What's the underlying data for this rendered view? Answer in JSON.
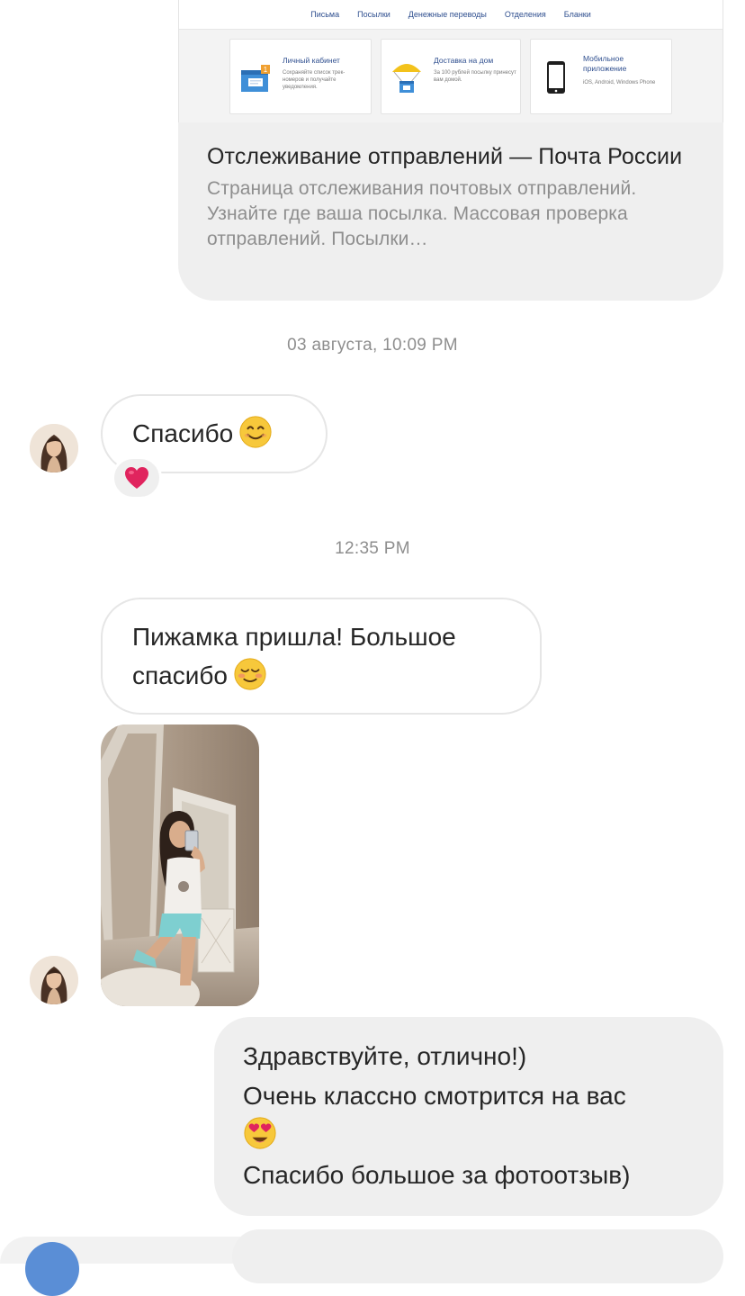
{
  "link_preview": {
    "nav_items": [
      "Письма",
      "Посылки",
      "Денежные переводы",
      "Отделения",
      "Бланки"
    ],
    "mini_cards": [
      {
        "title": "Личный кабинет",
        "desc": "Сохраняйте список трек-номеров и получайте уведомления."
      },
      {
        "title": "Доставка на дом",
        "desc": "За 100 рублей посылку принесут вам домой."
      },
      {
        "title": "Мобильное приложение",
        "desc": "iOS, Android, Windows Phone"
      }
    ],
    "badge_number": "1",
    "title": "Отслеживание отправлений — Почта России",
    "description": "Страница отслеживания почтовых отправлений. Узнайте где ваша посылка. Массовая проверка отправлений. Посылки…"
  },
  "timestamps": {
    "first": "03 августа, 10:09 PM",
    "second": "12:35 PM"
  },
  "messages": {
    "thanks": "Спасибо",
    "thanks_emoji": "smiling-face-icon",
    "reaction": "heart-icon",
    "pajama_line1": "Пижамка пришла! Большое",
    "pajama_line2": "спасибо",
    "pajama_emoji": "blushing-face-icon",
    "reply_line1": "Здравствуйте, отлично!)",
    "reply_line2": "Очень классно смотрится на вас",
    "reply_emoji": "heart-eyes-icon",
    "reply_line3": "Спасибо большое за фотоотзыв)"
  },
  "colors": {
    "outgoing_bubble": "#efefef",
    "incoming_border": "#e6e6e6",
    "timestamp_text": "#8e8e8e",
    "heart": "#e0245e",
    "link_blue": "#2f4f8f"
  }
}
